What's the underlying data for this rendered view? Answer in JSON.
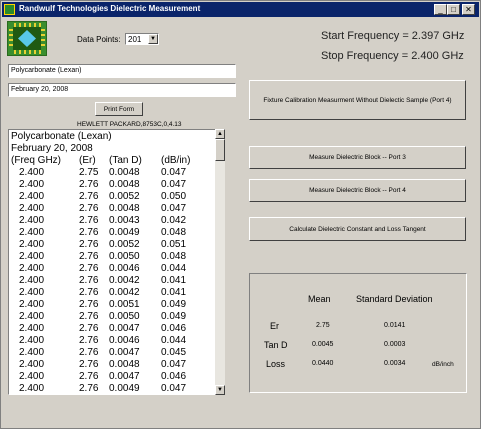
{
  "window": {
    "title": "Randwulf Technologies Dielectric Measurement"
  },
  "data_points": {
    "label": "Data Points:",
    "value": "201"
  },
  "sample_name": "Polycarbonate (Lexan)",
  "date": "February 20, 2008",
  "print_button": "Print Form",
  "instrument": "HEWLETT PACKARD,8753C,0,4.13",
  "frequency": {
    "start": "Start Frequency = 2.397  GHz",
    "stop": "Stop Frequency = 2.400  GHz"
  },
  "buttons": {
    "calibration": "Fixture Calibration Measurment Without Dielectic Sample (Port 4)",
    "port3": "Measure Dielectric Block -- Port 3",
    "port4": "Measure Dielectric Block -- Port 4",
    "calculate": "Calculate Dielectric Constant and Loss Tangent"
  },
  "list": {
    "line1": "Polycarbonate (Lexan)",
    "line2": "February 20, 2008",
    "headers": [
      "(Freq GHz)",
      "(Er)",
      "(Tan D)",
      "(dB/in)"
    ],
    "rows": [
      [
        "2.400",
        "2.75",
        "0.0048",
        "0.047"
      ],
      [
        "2.400",
        "2.76",
        "0.0048",
        "0.047"
      ],
      [
        "2.400",
        "2.76",
        "0.0052",
        "0.050"
      ],
      [
        "2.400",
        "2.76",
        "0.0048",
        "0.047"
      ],
      [
        "2.400",
        "2.76",
        "0.0043",
        "0.042"
      ],
      [
        "2.400",
        "2.76",
        "0.0049",
        "0.048"
      ],
      [
        "2.400",
        "2.76",
        "0.0052",
        "0.051"
      ],
      [
        "2.400",
        "2.76",
        "0.0050",
        "0.048"
      ],
      [
        "2.400",
        "2.76",
        "0.0046",
        "0.044"
      ],
      [
        "2.400",
        "2.76",
        "0.0042",
        "0.041"
      ],
      [
        "2.400",
        "2.76",
        "0.0042",
        "0.041"
      ],
      [
        "2.400",
        "2.76",
        "0.0051",
        "0.049"
      ],
      [
        "2.400",
        "2.76",
        "0.0050",
        "0.049"
      ],
      [
        "2.400",
        "2.76",
        "0.0047",
        "0.046"
      ],
      [
        "2.400",
        "2.76",
        "0.0046",
        "0.044"
      ],
      [
        "2.400",
        "2.76",
        "0.0047",
        "0.045"
      ],
      [
        "2.400",
        "2.76",
        "0.0048",
        "0.047"
      ],
      [
        "2.400",
        "2.76",
        "0.0047",
        "0.046"
      ],
      [
        "2.400",
        "2.76",
        "0.0049",
        "0.047"
      ]
    ]
  },
  "stats": {
    "mean_header": "Mean",
    "std_header": "Standard  Deviation",
    "er_label": "Er",
    "er_mean": "2.75",
    "er_std": "0.0141",
    "tand_label": "Tan D",
    "tand_mean": "0.0045",
    "tand_std": "0.0003",
    "loss_label": "Loss",
    "loss_mean": "0.0440",
    "loss_std": "0.0034",
    "loss_unit": "dB/inch"
  }
}
